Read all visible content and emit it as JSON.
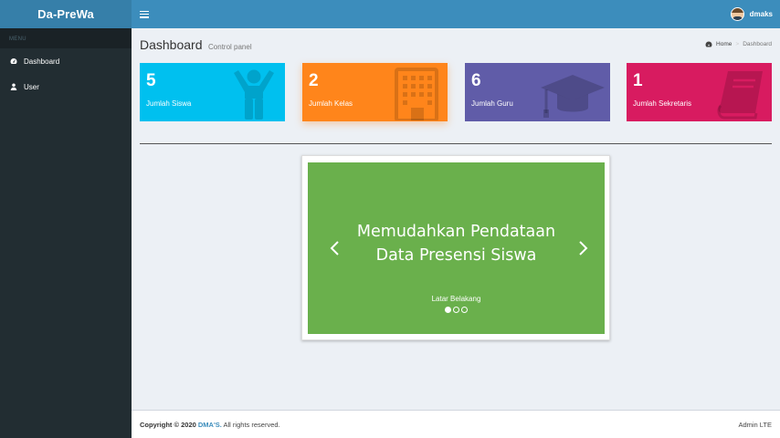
{
  "app": {
    "logo": "Da-PreWa"
  },
  "navbar": {
    "username": "dmaks",
    "toggle_icon": "hamburger-icon"
  },
  "sidebar": {
    "header": "MENU",
    "items": [
      {
        "label": "Dashboard",
        "icon": "dashboard-icon"
      },
      {
        "label": "User",
        "icon": "user-icon"
      }
    ]
  },
  "page": {
    "title": "Dashboard",
    "subtitle": "Control panel",
    "breadcrumb": {
      "home": "Home",
      "current": "Dashboard"
    }
  },
  "stats": [
    {
      "count": "5",
      "label": "Jumlah Siswa",
      "color": "#00c0ef",
      "icon": "child-icon"
    },
    {
      "count": "2",
      "label": "Jumlah Kelas",
      "color": "#ff851b",
      "icon": "building-icon"
    },
    {
      "count": "6",
      "label": "Jumlah Guru",
      "color": "#605ca8",
      "icon": "graduation-cap-icon"
    },
    {
      "count": "1",
      "label": "Jumlah Sekretaris",
      "color": "#d81b60",
      "icon": "book-icon"
    }
  ],
  "carousel": {
    "title_line1": "Memudahkan Pendataan",
    "title_line2": "Data Presensi Siswa",
    "caption": "Latar Belakang",
    "slide_count": 3,
    "active_index": 0,
    "color": "#6ab04c"
  },
  "footer": {
    "copyright_prefix": "Copyright © 2020",
    "brand": "DMA'S.",
    "rights": "All rights reserved.",
    "right_text": "Admin LTE"
  }
}
